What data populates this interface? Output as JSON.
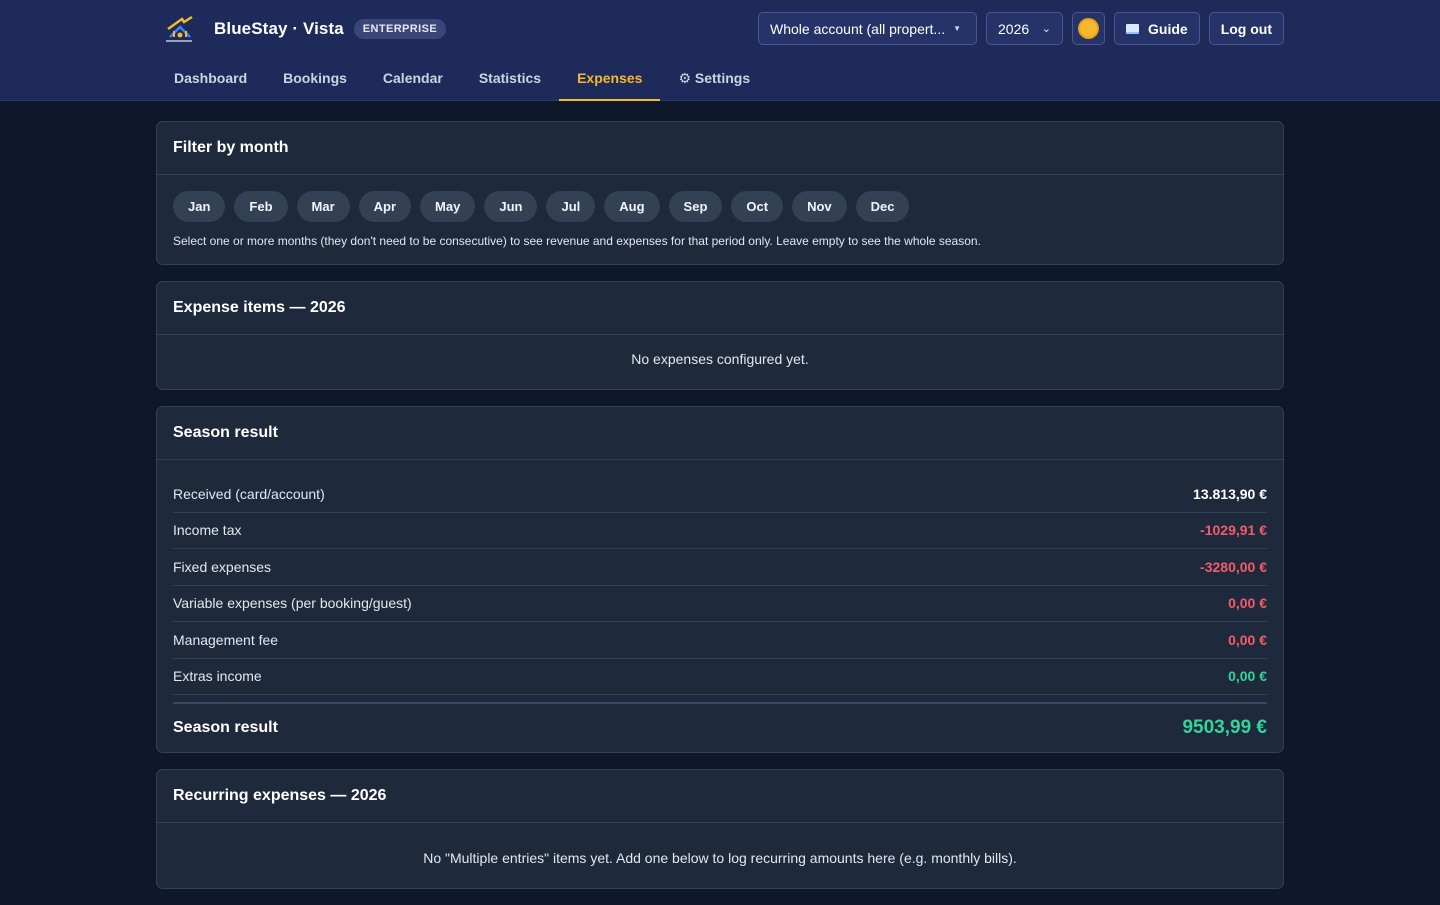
{
  "header": {
    "app_name": "BlueStay · Vista",
    "plan_badge": "ENTERPRISE",
    "property_select": "Whole account (all propert...",
    "year_select": "2026",
    "guide_label": "Guide",
    "logout_label": "Log out"
  },
  "nav": {
    "dashboard": "Dashboard",
    "bookings": "Bookings",
    "calendar": "Calendar",
    "statistics": "Statistics",
    "expenses": "Expenses",
    "settings": "⚙ Settings"
  },
  "filter": {
    "title": "Filter by month",
    "months": [
      "Jan",
      "Feb",
      "Mar",
      "Apr",
      "May",
      "Jun",
      "Jul",
      "Aug",
      "Sep",
      "Oct",
      "Nov",
      "Dec"
    ],
    "hint": "Select one or more months (they don't need to be consecutive) to see revenue and expenses for that period only. Leave empty to see the whole season."
  },
  "expense_items": {
    "title": "Expense items — 2026",
    "empty": "No expenses configured yet."
  },
  "season_result": {
    "title": "Season result",
    "rows": [
      {
        "label": "Received (card/account)",
        "value": "13.813,90 €"
      },
      {
        "label": "Income tax",
        "value": "-1029,91 €"
      },
      {
        "label": "Fixed expenses",
        "value": "-3280,00 €"
      },
      {
        "label": "Variable expenses (per booking/guest)",
        "value": "0,00 €"
      },
      {
        "label": "Management fee",
        "value": "0,00 €"
      },
      {
        "label": "Extras income",
        "value": "0,00 €"
      }
    ],
    "total_label": "Season result",
    "total_value": "9503,99 €"
  },
  "recurring": {
    "title": "Recurring expenses — 2026",
    "empty": "No \"Multiple entries\" items yet. Add one below to log recurring amounts here (e.g. monthly bills)."
  },
  "colors": {
    "accent": "#f5b82e",
    "negative": "#f25c6a",
    "positive": "#34d399",
    "neutral": "#ffffff"
  }
}
